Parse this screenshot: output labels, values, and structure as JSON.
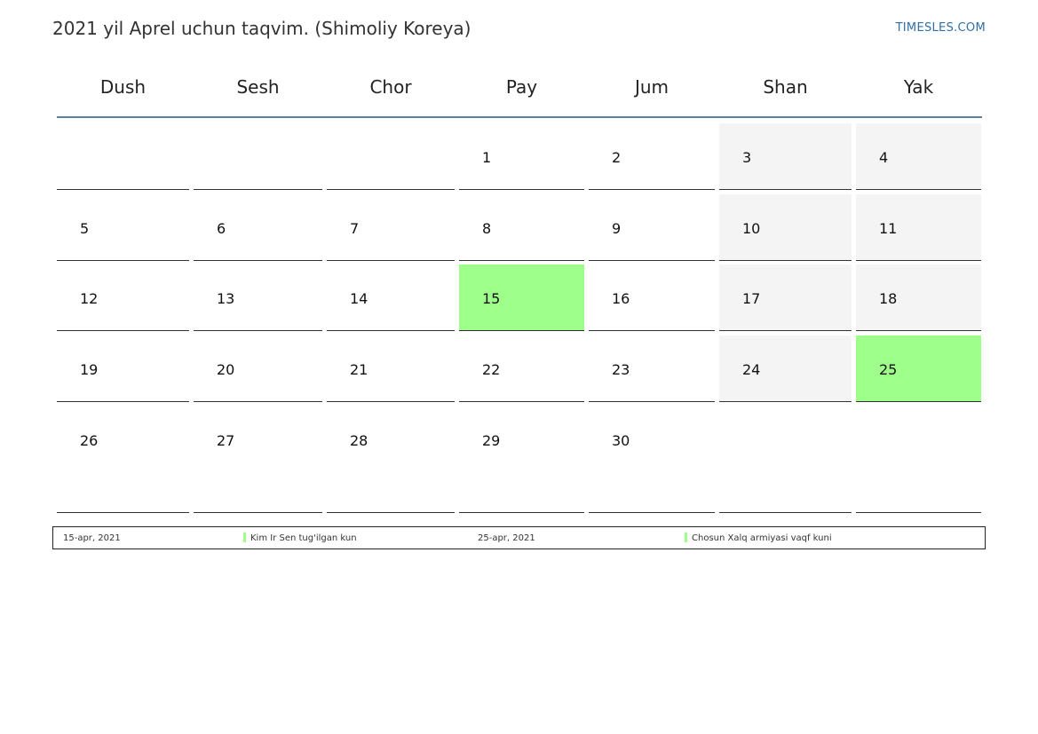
{
  "header": {
    "title": "2021 yil Aprel uchun taqvim. (Shimoliy Koreya)",
    "site": "TIMESLES.COM"
  },
  "colors": {
    "holiday": "#9eff8a",
    "weekend": "#f4f4f4",
    "header_rule": "#5c7fa6",
    "link": "#2f6fa8"
  },
  "weekdays": [
    "Dush",
    "Sesh",
    "Chor",
    "Pay",
    "Jum",
    "Shan",
    "Yak"
  ],
  "weeks": [
    [
      "",
      "",
      "",
      "1",
      "2",
      "3",
      "4"
    ],
    [
      "5",
      "6",
      "7",
      "8",
      "9",
      "10",
      "11"
    ],
    [
      "12",
      "13",
      "14",
      "15",
      "16",
      "17",
      "18"
    ],
    [
      "19",
      "20",
      "21",
      "22",
      "23",
      "24",
      "25"
    ],
    [
      "26",
      "27",
      "28",
      "29",
      "30",
      "",
      ""
    ]
  ],
  "holidays": [
    "15",
    "25"
  ],
  "legend": [
    {
      "date": "15-apr, 2021",
      "name": "Kim Ir Sen tug'ilgan kun"
    },
    {
      "date": "25-apr, 2021",
      "name": "Chosun Xalq armiyasi vaqf kuni"
    }
  ]
}
